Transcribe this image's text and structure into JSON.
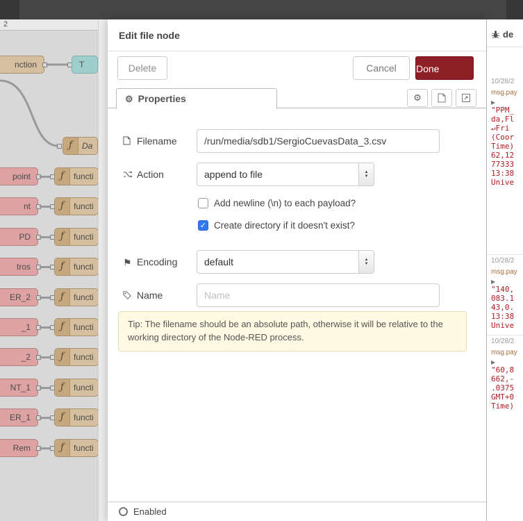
{
  "icons": {
    "gear": "⚙",
    "flag": "⚑",
    "function_glyph": "ƒ",
    "arrow": "▶",
    "spin_up": "▲",
    "spin_down": "▼",
    "check": "✓"
  },
  "flow": {
    "tab_label": "2",
    "top_node": {
      "label": "nction"
    },
    "teal_node": {
      "label": "T"
    },
    "da_node": {
      "label": "Da"
    },
    "rows": [
      {
        "node": "point",
        "func": "functi"
      },
      {
        "node": "nt",
        "func": "functi"
      },
      {
        "node": "PD",
        "func": "functi"
      },
      {
        "node": "tros",
        "func": "functi"
      },
      {
        "node": "ER_2",
        "func": "functi"
      },
      {
        "node": "_1",
        "func": "functi"
      },
      {
        "node": "_2",
        "func": "functi"
      },
      {
        "node": "NT_1",
        "func": "functi"
      },
      {
        "node": "ER_1",
        "func": "functi"
      },
      {
        "node": "Rem",
        "func": "functi"
      }
    ]
  },
  "dialog": {
    "title": "Edit file node",
    "delete_label": "Delete",
    "cancel_label": "Cancel",
    "done_label": "Done",
    "tab_label": "Properties",
    "filename": {
      "label": "Filename",
      "value": "/run/media/sdb1/SergioCuevasData_3.csv"
    },
    "action": {
      "label": "Action",
      "value": "append to file"
    },
    "newline_checkbox": {
      "label": "Add newline (\\n) to each payload?"
    },
    "create_checkbox": {
      "label": "Create directory if it doesn't exist?"
    },
    "encoding": {
      "label": "Encoding",
      "value": "default"
    },
    "name": {
      "label": "Name",
      "placeholder": "Name"
    },
    "tip": "Tip: The filename should be an absolute path, otherwise it will be relative to the working directory of the Node-RED process.",
    "enabled_label": "Enabled"
  },
  "debug": {
    "title": "de",
    "messages": [
      {
        "timestamp": "10/28/2",
        "meta": "msg.pay",
        "lines": [
          "\"PPM_",
          "da,Fl",
          "↵Fri",
          "(Coor",
          "Time)",
          "62,12",
          "77333",
          "13:38",
          "Unive"
        ]
      },
      {
        "timestamp": "10/28/2",
        "meta": "msg.pay",
        "lines": [
          "\"140,",
          "083.1",
          "43,0.",
          "13:38",
          "Unive"
        ]
      },
      {
        "timestamp": "10/28/2",
        "meta": "msg.pay",
        "lines": [
          "\"60,8",
          "662,-",
          ".0375",
          "GMT+0",
          "Time)"
        ]
      }
    ]
  }
}
